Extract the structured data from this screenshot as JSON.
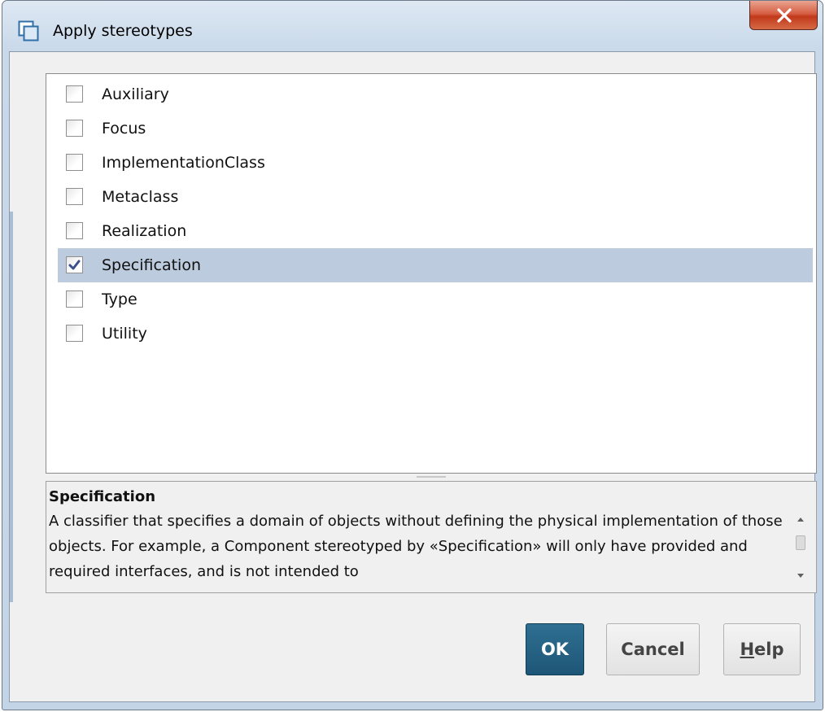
{
  "window": {
    "title": "Apply stereotypes",
    "icon": "dialog-window-icon",
    "close_icon": "close-x-icon"
  },
  "stereotypes": {
    "items": [
      {
        "label": "Auxiliary",
        "checked": false,
        "selected": false
      },
      {
        "label": "Focus",
        "checked": false,
        "selected": false
      },
      {
        "label": "ImplementationClass",
        "checked": false,
        "selected": false
      },
      {
        "label": "Metaclass",
        "checked": false,
        "selected": false
      },
      {
        "label": "Realization",
        "checked": false,
        "selected": false
      },
      {
        "label": "Specification",
        "checked": true,
        "selected": true
      },
      {
        "label": "Type",
        "checked": false,
        "selected": false
      },
      {
        "label": "Utility",
        "checked": false,
        "selected": false
      }
    ]
  },
  "description": {
    "title": "Specification",
    "body": "A classifier that specifies a domain of objects without defining the physical implementation of those objects. For example, a Component stereotyped by «Specification» will only have provided and required interfaces, and is not intended to"
  },
  "buttons": {
    "ok_label": "OK",
    "cancel_label": "Cancel",
    "help_label": "Help",
    "help_mnemonic": "H",
    "help_rest": "elp"
  },
  "colors": {
    "selected_row": "#bccbdd",
    "ok_button": "#1e5677",
    "close_button": "#c2391b"
  }
}
